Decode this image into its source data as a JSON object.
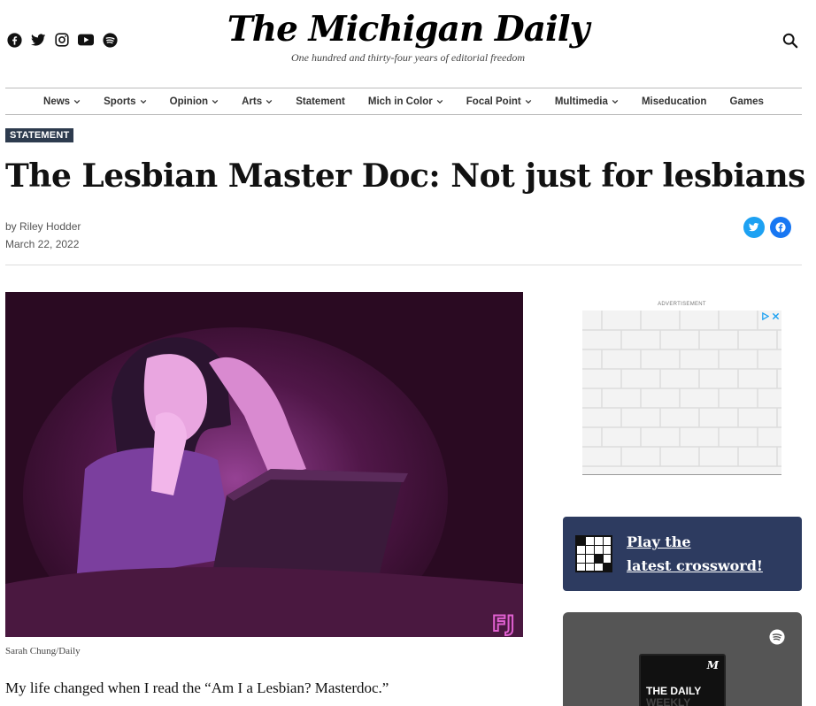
{
  "header": {
    "logo": "The Michigan Daily",
    "tagline": "One hundred and thirty-four years of editorial freedom",
    "social_icons": [
      "facebook-icon",
      "twitter-icon",
      "instagram-icon",
      "youtube-icon",
      "spotify-icon"
    ]
  },
  "nav": {
    "items": [
      {
        "label": "News",
        "dropdown": true
      },
      {
        "label": "Sports",
        "dropdown": true
      },
      {
        "label": "Opinion",
        "dropdown": true
      },
      {
        "label": "Arts",
        "dropdown": true
      },
      {
        "label": "Statement",
        "dropdown": false
      },
      {
        "label": "Mich in Color",
        "dropdown": true
      },
      {
        "label": "Focal Point",
        "dropdown": true
      },
      {
        "label": "Multimedia",
        "dropdown": true
      },
      {
        "label": "Miseducation",
        "dropdown": false
      },
      {
        "label": "Games",
        "dropdown": false
      }
    ]
  },
  "article": {
    "kicker": "STATEMENT",
    "title": "The Lesbian Master Doc: Not just for lesbians",
    "byline": "by Riley Hodder",
    "date": "March 22, 2022",
    "image_credit": "Sarah Chung/Daily",
    "first_paragraph": "My life changed when I read the “Am I a Lesbian? Masterdoc.”"
  },
  "sidebar": {
    "ad_label": "ADVERTISEMENT",
    "crossword_line1": "Play the",
    "crossword_line2": "latest crossword!",
    "podcast_logo": "M",
    "podcast_title_1": "THE DAILY",
    "podcast_title_2": "WEEKLY"
  },
  "colors": {
    "kicker_bg": "#2d3b4e",
    "twitter": "#1da1f2",
    "facebook": "#1877f2",
    "crossword_bg": "#2d3b60"
  }
}
